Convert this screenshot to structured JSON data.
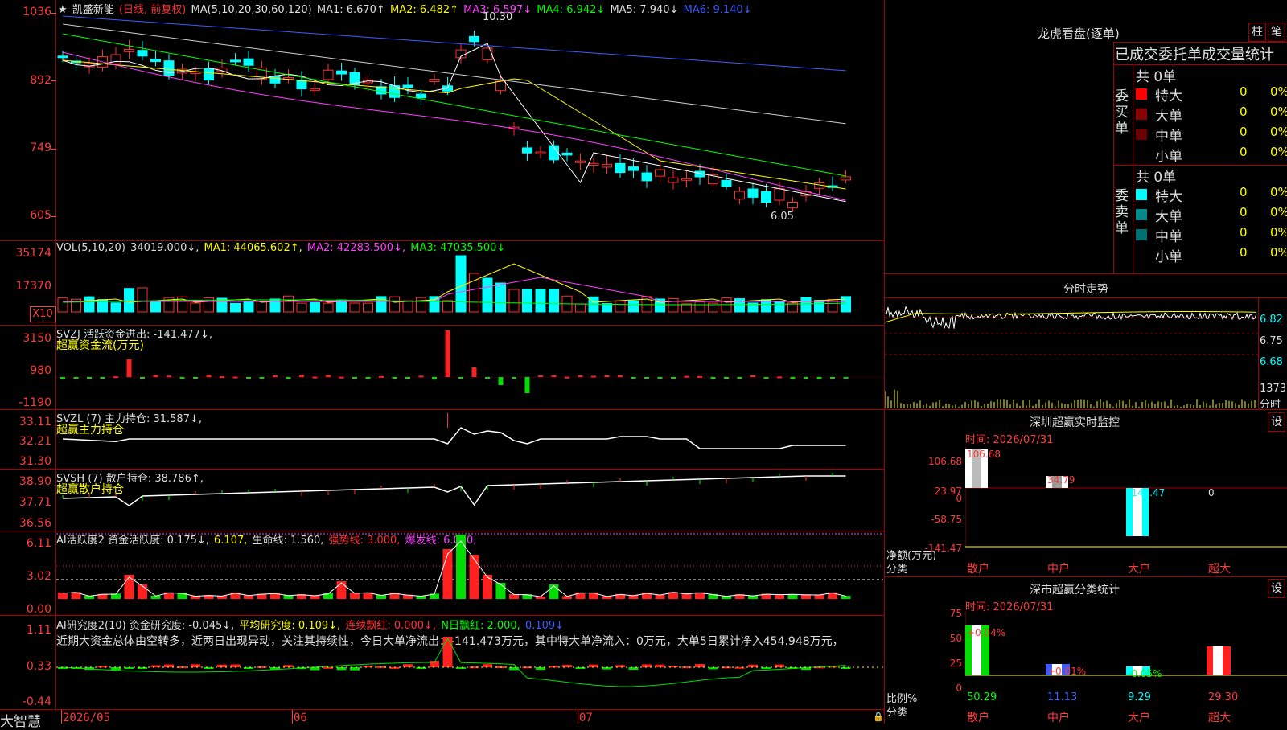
{
  "kline": {
    "title_star": "★",
    "title_name": "凯盛新能",
    "title_mode": "(日线, 前复权)",
    "ma_params": "MA(5,10,20,30,60,120)",
    "ma1": "MA1: 6.670↑",
    "ma2": "MA2: 6.482↑",
    "ma3": "MA3: 6.597↓",
    "ma4": "MA4: 6.942↓",
    "ma5": "MA5: 7.940↓",
    "ma6": "MA6: 9.140↓",
    "high_note": "10.30",
    "low_note": "6.05",
    "axis": [
      "1036",
      "892",
      "749",
      "605"
    ]
  },
  "vol": {
    "label": "VOL(5,10,20)",
    "value": "34019.000↓,",
    "ma1": "MA1: 44065.602↑,",
    "ma2": "MA2: 42283.500↓,",
    "ma3": "MA3: 47035.500↓",
    "axis": [
      "35174",
      "17370"
    ],
    "unit": "X10"
  },
  "svzj": {
    "label": "SVZJ  活跃资金进出: -141.477↓,",
    "sub": "超赢资金流(万元)",
    "axis": [
      "3150",
      "980",
      "-1190"
    ]
  },
  "svzl": {
    "label": "SVZL (7) 主力持仓: 31.587↓,",
    "sub": "超赢主力持仓",
    "axis": [
      "33.11",
      "32.21",
      "31.30"
    ]
  },
  "svsh": {
    "label": "SVSH (7) 散户持仓: 38.786↑,",
    "sub": "超赢散户持仓",
    "axis": [
      "38.90",
      "37.71",
      "36.56"
    ]
  },
  "ai1": {
    "label": "AI活跃度2 资金活跃度: 0.175↓,",
    "v2": "6.107,",
    "v3": "生命线: 1.560,",
    "v4": "强势线: 3.000,",
    "v5": "爆发线: 6.000,",
    "axis": [
      "6.11",
      "3.02",
      "0.00"
    ]
  },
  "ai2": {
    "label": "AI研究度2(10) 资金研究度: -0.045↓,",
    "v2": "平均研究度: 0.109↓,",
    "v3": "连续飘红: 0.000↓,",
    "v4": "N日飘红: 2.000,",
    "v5": "0.109↓",
    "comment": "近期大资金总体由空转多，近两日出现异动，关注其持续性，今日大单净流出：-141.473万元，其中特大单净流入：0万元，大单5日累计净入454.948万元，",
    "axis": [
      "1.11",
      "0.33",
      "-0.44"
    ]
  },
  "bottom": {
    "logo": "大智慧",
    "dates": [
      "2026/05",
      "06",
      "07"
    ]
  },
  "right": {
    "dragon_title": "龙虎看盘(逐单)",
    "btn1": "柱",
    "btn2": "笔",
    "tabs_line": "已成交委托单成交量统计",
    "buy_group": "委买单",
    "buy_total": "共 0单",
    "sell_group": "委卖单",
    "sell_total": "共 0单",
    "buy_rows": [
      {
        "label": "特大",
        "n": "0",
        "p": "0%",
        "color": "#ff0000"
      },
      {
        "label": "大单",
        "n": "0",
        "p": "0%",
        "color": "#8b0000"
      },
      {
        "label": "中单",
        "n": "0",
        "p": "0%",
        "color": "#6a0000"
      },
      {
        "label": "小单",
        "n": "0",
        "p": "0%",
        "color": "#000000"
      }
    ],
    "sell_rows": [
      {
        "label": "特大",
        "n": "0",
        "p": "0%",
        "color": "#00ffff"
      },
      {
        "label": "大单",
        "n": "0",
        "p": "0%",
        "color": "#008b8b"
      },
      {
        "label": "中单",
        "n": "0",
        "p": "0%",
        "color": "#007070"
      },
      {
        "label": "小单",
        "n": "0",
        "p": "0%",
        "color": "#000000"
      }
    ],
    "intraday_title": "分时走势",
    "intraday_axis": [
      "6.82",
      "6.75",
      "6.68",
      "1373",
      "分时"
    ],
    "monitor_title": "深圳超赢实时监控",
    "monitor_btn": "设",
    "monitor_time": "时间: 2026/07/31",
    "monitor_axis": [
      "106.68",
      "23.97",
      "0",
      "-58.75",
      "-141.47"
    ],
    "monitor_values": [
      "106.68",
      "34.79",
      "-141.47",
      "0"
    ],
    "monitor_ylabel": "净额(万元)",
    "monitor_xlabel": "分类",
    "monitor_cats": [
      "散户",
      "中户",
      "大户",
      "超大"
    ],
    "class_title": "深市超赢分类统计",
    "class_btn": "设",
    "class_time": "时间: 2026/07/31",
    "class_axis": [
      "75",
      "50",
      "25",
      "0"
    ],
    "class_pct": [
      "+0.04%",
      "+0.01%",
      "-0.05%"
    ],
    "class_values": [
      "50.29",
      "11.13",
      "9.29",
      "29.30"
    ],
    "class_ylabel": "比例%",
    "class_xlabel": "分类",
    "class_cats": [
      "散户",
      "中户",
      "大户",
      "超大"
    ]
  }
}
